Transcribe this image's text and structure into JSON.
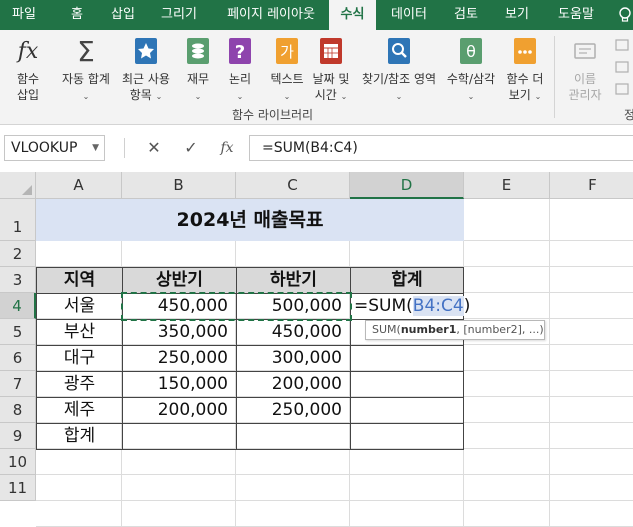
{
  "tabs": [
    "파일",
    "홈",
    "삽입",
    "그리기",
    "페이지 레이아웃",
    "수식",
    "데이터",
    "검토",
    "보기",
    "도움말"
  ],
  "active_tab": "수식",
  "ribbon": {
    "insert_function": {
      "line1": "함수",
      "line2": "삽입",
      "icon": "fx-icon"
    },
    "autosum": {
      "label": "자동 합계",
      "icon": "sigma-icon"
    },
    "recent": {
      "line1": "최근 사용",
      "line2": "항목",
      "icon": "star-book-icon"
    },
    "financial": {
      "label": "재무",
      "icon": "coins-book-icon"
    },
    "logical": {
      "label": "논리",
      "icon": "question-book-icon"
    },
    "text": {
      "label": "텍스트",
      "icon": "text-book-icon"
    },
    "datetime": {
      "line1": "날짜 및",
      "line2": "시간",
      "icon": "calendar-book-icon"
    },
    "lookup": {
      "label": "찾기/참조 영역",
      "icon": "magnifier-book-icon"
    },
    "math": {
      "label": "수학/삼각",
      "icon": "theta-book-icon"
    },
    "more": {
      "line1": "함수 더",
      "line2": "보기",
      "icon": "dots-book-icon"
    },
    "name_manager": {
      "line1": "이름",
      "line2": "관리자",
      "icon": "name-manager-icon"
    },
    "group_label": "함수 라이브러리",
    "group_label_cut": "정"
  },
  "name_box": "VLOOKUP",
  "formula": "=SUM(B4:C4)",
  "columns": [
    "A",
    "B",
    "C",
    "D",
    "E",
    "F"
  ],
  "rows": [
    "1",
    "2",
    "3",
    "4",
    "5",
    "6",
    "7",
    "8",
    "9",
    "10",
    "11"
  ],
  "title": "2024년 매출목표",
  "table_headers": [
    "지역",
    "상반기",
    "하반기",
    "합계"
  ],
  "table_rows": [
    {
      "region": "서울",
      "h1": "450,000",
      "h2": "500,000"
    },
    {
      "region": "부산",
      "h1": "350,000",
      "h2": "450,000"
    },
    {
      "region": "대구",
      "h1": "250,000",
      "h2": "300,000"
    },
    {
      "region": "광주",
      "h1": "150,000",
      "h2": "200,000"
    },
    {
      "region": "제주",
      "h1": "200,000",
      "h2": "250,000"
    }
  ],
  "total_label": "합계",
  "edit_cell": {
    "prefix": "=SUM(",
    "ref": "B4:C4",
    "suffix": ")"
  },
  "tooltip": {
    "fn": "SUM(",
    "arg1": "number1",
    "rest": ", [number2], ...)"
  },
  "colors": {
    "accent": "#217346",
    "ref_blue": "#4472c4",
    "title_fill": "#dae3f3",
    "header_fill": "#d9d9d9"
  }
}
